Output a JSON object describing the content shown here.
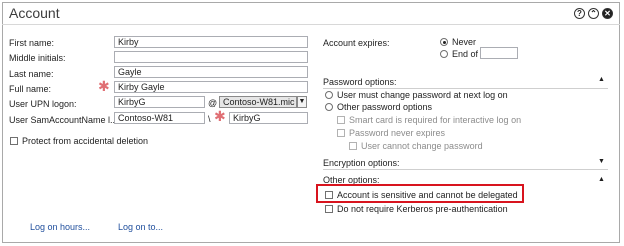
{
  "window": {
    "title": "Account"
  },
  "header_buttons": {
    "help": "?",
    "collapse": "⌃",
    "close": "✕"
  },
  "left": {
    "first_name_label": "First name:",
    "first_name_value": "Kirby",
    "middle_initials_label": "Middle initials:",
    "middle_initials_value": "",
    "last_name_label": "Last name:",
    "last_name_value": "Gayle",
    "full_name_label": "Full name:",
    "full_name_value": "Kirby Gayle",
    "upn_label": "User UPN logon:",
    "upn_value": "KirbyG",
    "upn_at": "@",
    "upn_domain": "Contoso-W81.mic",
    "sam_label": "User SamAccountName l...",
    "sam_domain": "Contoso-W81",
    "sam_sep": "\\",
    "sam_value": "KirbyG",
    "protect_label": "Protect from accidental deletion"
  },
  "links": {
    "log_on_hours": "Log on hours...",
    "log_on_to": "Log on to..."
  },
  "right": {
    "account_expires_label": "Account expires:",
    "never_label": "Never",
    "end_of_label": "End of",
    "password_options_header": "Password options:",
    "pw_user_must_change": "User must change password at next log on",
    "pw_other_options": "Other password options",
    "pw_smart_card": "Smart card is required for interactive log on",
    "pw_never_expires": "Password never expires",
    "pw_cannot_change": "User cannot change password",
    "encryption_header": "Encryption options:",
    "other_header": "Other options:",
    "opt_sensitive": "Account is sensitive and cannot be delegated",
    "opt_no_preauth": "Do not require Kerberos pre-authentication"
  },
  "highlight_color": "#d8141e",
  "accent_link_color": "#1f4e9c",
  "icons": [
    "help-icon",
    "collapse-icon",
    "close-icon",
    "required-asterisk-icon",
    "dropdown-arrow-icon",
    "collapse-triangle-icon",
    "expand-triangle-icon"
  ]
}
